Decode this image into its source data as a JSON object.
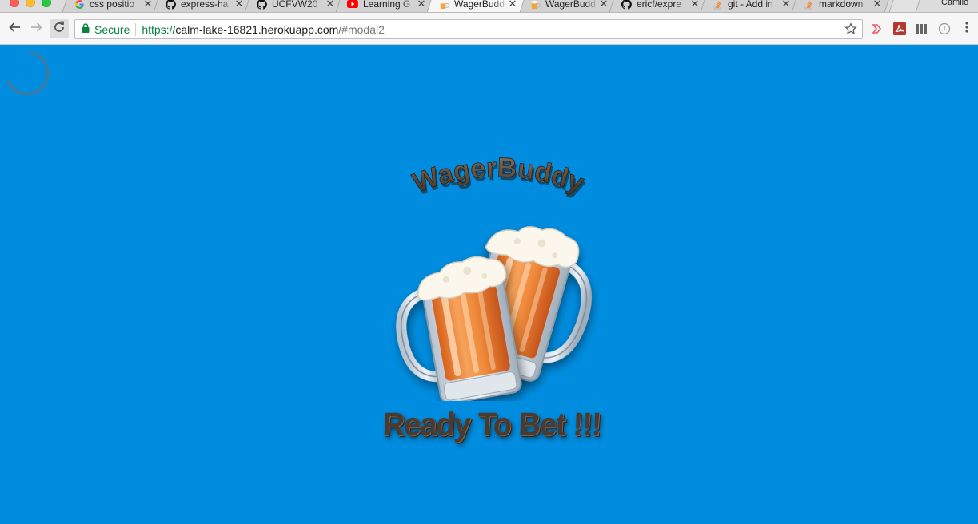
{
  "browser": {
    "tabs": [
      {
        "title": "css positio",
        "favicon": "google-icon",
        "active": false
      },
      {
        "title": "express-ha",
        "favicon": "github-icon",
        "active": false
      },
      {
        "title": "UCFVW20",
        "favicon": "github-icon",
        "active": false
      },
      {
        "title": "Learning G",
        "favicon": "youtube-icon",
        "active": false
      },
      {
        "title": "WagerBudd",
        "favicon": "beer-icon",
        "active": true
      },
      {
        "title": "WagerBudd",
        "favicon": "beer-icon",
        "active": false
      },
      {
        "title": "ericf/expre",
        "favicon": "github-icon",
        "active": false
      },
      {
        "title": "git - Add in",
        "favicon": "stackoverflow-icon",
        "active": false
      },
      {
        "title": "markdown",
        "favicon": "stackoverflow-icon",
        "active": false
      }
    ],
    "close_glyph": "✕",
    "profile_name": "Camilo",
    "toolbar": {
      "secure_label": "Secure",
      "url_scheme": "https://",
      "url_host": "calm-lake-16821.herokuapp.com",
      "url_rest": "/#modal2"
    }
  },
  "page": {
    "background_color": "#008ddf",
    "brand_title": "WagerBuddy",
    "tagline": "Ready To Bet !!!",
    "text_color": "#4a3a2f"
  }
}
